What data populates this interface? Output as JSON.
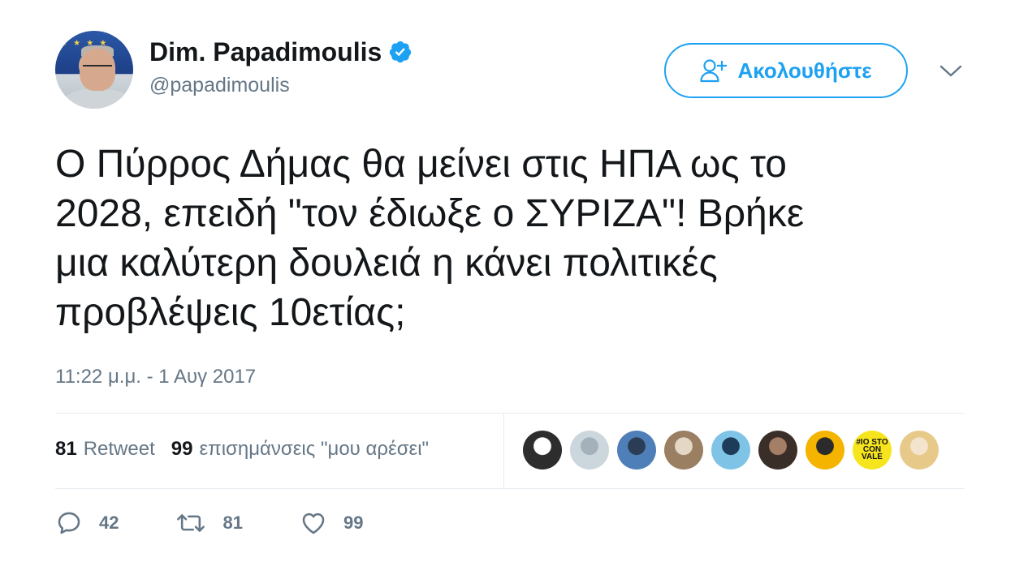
{
  "user": {
    "display_name": "Dim. Papadimoulis",
    "screen_name": "@papadimoulis",
    "verified": true
  },
  "follow_button": {
    "label": "Ακολουθήστε"
  },
  "tweet": {
    "text": "Ο Πύρρος Δήμας θα μείνει στις ΗΠΑ ως το\n2028, επειδή \"τον έδιωξε ο ΣΥΡΙΖΑ\"! Βρήκε\nμια καλύτερη δουλειά η κάνει πολιτικές\nπροβλέψεις 10ετίας;",
    "timestamp": "11:22 μ.μ. - 1 Αυγ 2017"
  },
  "stats": {
    "retweet_count": "81",
    "retweet_label": "Retweet",
    "like_count": "99",
    "like_label": "επισημάνσεις \"μου αρέσει\""
  },
  "likers": [
    {
      "name": "husky-avatar",
      "colors": [
        "#2d2d2d",
        "#ffffff"
      ]
    },
    {
      "name": "default-avatar",
      "colors": [
        "#ccd6dd",
        "#a4b1ba"
      ]
    },
    {
      "name": "coast-avatar",
      "colors": [
        "#4f7fb8",
        "#2a3d55"
      ]
    },
    {
      "name": "room-avatar",
      "colors": [
        "#9a7f63",
        "#e4d7c6"
      ]
    },
    {
      "name": "sunglasses-avatar",
      "colors": [
        "#7fc4e6",
        "#1d3c58"
      ]
    },
    {
      "name": "man-avatar",
      "colors": [
        "#3a2e28",
        "#a57e66"
      ]
    },
    {
      "name": "woman-avatar",
      "colors": [
        "#f4b400",
        "#2b2b2b"
      ]
    },
    {
      "name": "iostoconvale-avatar",
      "colors": [
        "#f6e51e",
        "#111111"
      ],
      "text": "#IO STO CON VALE"
    },
    {
      "name": "blonde-avatar",
      "colors": [
        "#e7c98a",
        "#f3e5cd"
      ]
    }
  ],
  "actions": {
    "reply_count": "42",
    "retweet_count": "81",
    "like_count": "99"
  },
  "colors": {
    "accent": "#1da1f2",
    "secondary_text": "#657786",
    "primary_text": "#14171a",
    "divider": "#e6ecf0"
  }
}
